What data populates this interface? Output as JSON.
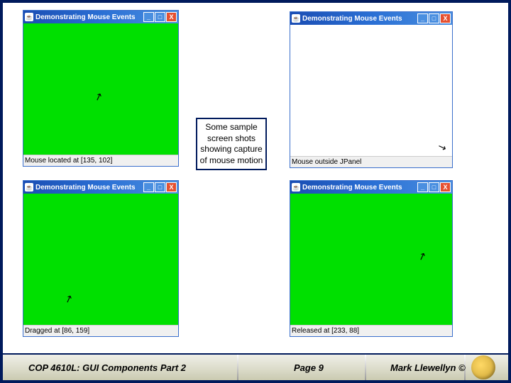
{
  "windows": {
    "w1": {
      "title": "Demonstrating Mouse Events",
      "status": "Mouse located at [135, 102]"
    },
    "w2": {
      "title": "Demonstrating Mouse Events",
      "status": "Mouse outside JPanel"
    },
    "w3": {
      "title": "Demonstrating Mouse Events",
      "status": "Dragged at [86, 159]"
    },
    "w4": {
      "title": "Demonstrating Mouse Events",
      "status": "Released at [233, 88]"
    }
  },
  "win_buttons": {
    "min": "_",
    "max": "□",
    "close": "X"
  },
  "java_icon": "☕",
  "cursor_glyph": "↗",
  "cursor_glyph_down": "↘",
  "caption": "Some sample screen shots showing capture of mouse motion",
  "footer": {
    "course": "COP 4610L: GUI Components Part 2",
    "page": "Page 9",
    "author": "Mark Llewellyn ©"
  }
}
